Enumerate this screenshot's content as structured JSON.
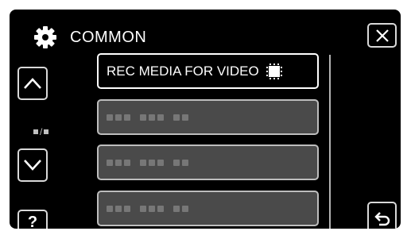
{
  "header": {
    "title": "COMMON",
    "icon": "gear-icon"
  },
  "nav": {
    "up_icon": "chevron-up-icon",
    "down_icon": "chevron-down-icon",
    "page_indicator": "▪/▪",
    "help_label": "?",
    "close_icon": "close-icon",
    "back_icon": "return-icon"
  },
  "menu": {
    "items": [
      {
        "label": "REC MEDIA FOR VIDEO",
        "icon": "memory-chip-icon",
        "selected": true
      },
      {
        "label": "",
        "placeholder": true
      },
      {
        "label": "",
        "placeholder": true
      },
      {
        "label": "",
        "placeholder": true
      }
    ]
  },
  "colors": {
    "background": "#000000",
    "item_bg": "#4a4a4a",
    "border": "#d9d9d9"
  }
}
